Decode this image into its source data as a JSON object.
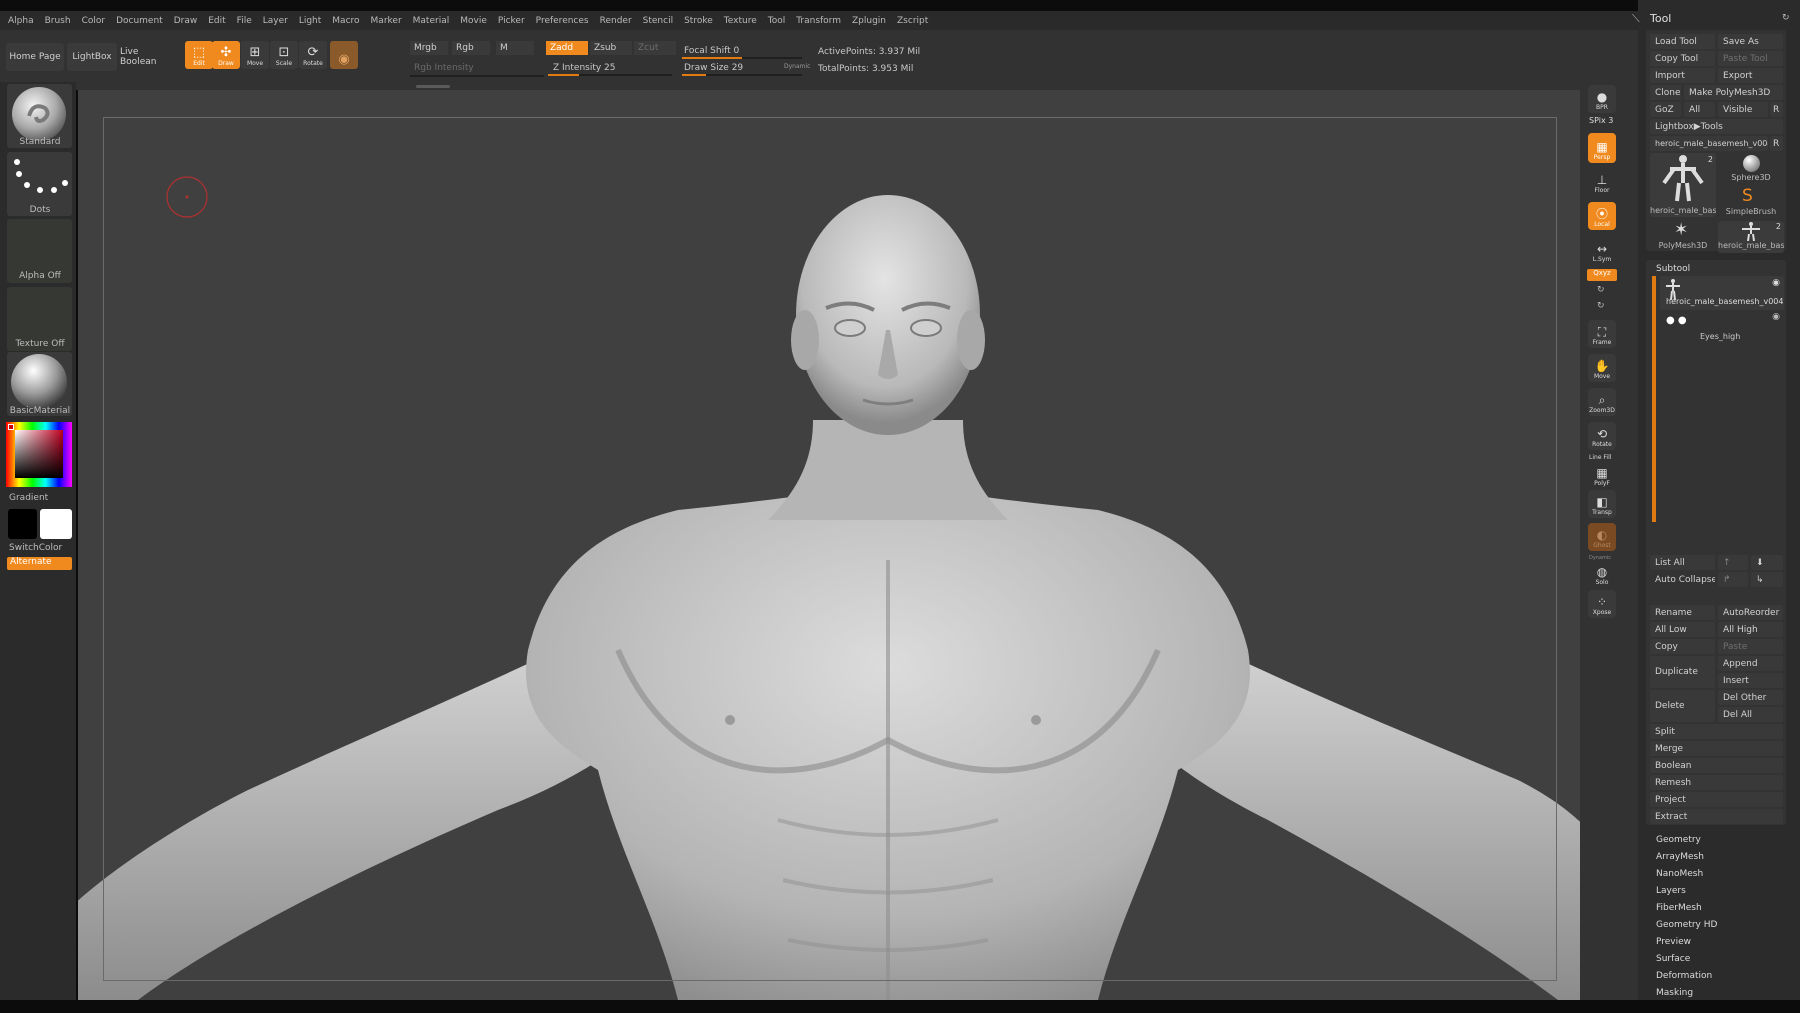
{
  "menu": [
    "Alpha",
    "Brush",
    "Color",
    "Document",
    "Draw",
    "Edit",
    "File",
    "Layer",
    "Light",
    "Macro",
    "Marker",
    "Material",
    "Movie",
    "Picker",
    "Preferences",
    "Render",
    "Stencil",
    "Stroke",
    "Texture",
    "Tool",
    "Transform",
    "Zplugin",
    "Zscript"
  ],
  "shelf": {
    "home_page": "Home Page",
    "lightbox": "LightBox",
    "live_boolean": "Live Boolean",
    "edit": "Edit",
    "draw": "Draw",
    "move": "Move",
    "scale": "Scale",
    "rotate": "Rotate",
    "mrgb": "Mrgb",
    "rgb": "Rgb",
    "m": "M",
    "rgb_intensity": "Rgb Intensity",
    "zadd": "Zadd",
    "zsub": "Zsub",
    "zcut": "Zcut",
    "z_intensity": "Z Intensity 25",
    "z_intensity_value": 0.25,
    "focal_shift": "Focal Shift 0",
    "focal_shift_value": 0.5,
    "draw_size": "Draw Size 29",
    "draw_size_value": 0.2,
    "dynamic": "Dynamic",
    "active_points": "ActivePoints: 3.937 Mil",
    "total_points": "TotalPoints: 3.953 Mil"
  },
  "left": {
    "brush": "Standard",
    "stroke": "Dots",
    "alpha": "Alpha Off",
    "texture": "Texture Off",
    "material": "BasicMaterial",
    "gradient": "Gradient",
    "switch_color": "SwitchColor",
    "alternate": "Alternate"
  },
  "right_shelf": {
    "bpr": "BPR",
    "spix": "SPix 3",
    "persp": "Persp",
    "dynamic": "Dynamic",
    "floor": "Floor",
    "local": "Local",
    "lsym": "L.Sym",
    "xyz": "Qxyz",
    "frame": "Frame",
    "move": "Move",
    "zoom3d": "Zoom3D",
    "rotate": "Rotate",
    "line_fill": "Line Fill",
    "polyf": "PolyF",
    "transp": "Transp",
    "ghost": "Ghost",
    "solo": "Solo",
    "xpose": "Xpose"
  },
  "tool": {
    "title": "Tool",
    "load_tool": "Load Tool",
    "save_as": "Save As",
    "copy_tool": "Copy Tool",
    "paste_tool": "Paste Tool",
    "import": "Import",
    "export": "Export",
    "clone": "Clone",
    "make_polymesh": "Make PolyMesh3D",
    "goz": "GoZ",
    "all": "All",
    "visible": "Visible",
    "r": "R",
    "lightbox_tools": "Lightbox▶Tools",
    "current_tool": "heroic_male_basemesh_v004",
    "thumbs": [
      {
        "label": "heroic_male_bas",
        "count": "2"
      },
      {
        "label": "Sphere3D",
        "count": ""
      },
      {
        "label": "SimpleBrush",
        "count": ""
      },
      {
        "label": "PolyMesh3D",
        "count": ""
      },
      {
        "label": "heroic_male_bas",
        "count": "2"
      }
    ]
  },
  "subtool": {
    "title": "Subtool",
    "items": [
      "heroic_male_basemesh_v004",
      "Eyes_high"
    ],
    "list_all": "List All",
    "auto_collapse": "Auto Collapse",
    "rename": "Rename",
    "auto_reorder": "AutoReorder",
    "all_low": "All Low",
    "all_high": "All High",
    "copy": "Copy",
    "paste": "Paste",
    "duplicate": "Duplicate",
    "append": "Append",
    "insert": "Insert",
    "delete": "Delete",
    "del_other": "Del Other",
    "del_all": "Del All",
    "split": "Split",
    "merge": "Merge",
    "boolean": "Boolean",
    "remesh": "Remesh",
    "project": "Project",
    "extract": "Extract"
  },
  "sections": [
    "Geometry",
    "ArrayMesh",
    "NanoMesh",
    "Layers",
    "FiberMesh",
    "Geometry HD",
    "Preview",
    "Surface",
    "Deformation",
    "Masking"
  ],
  "colors": {
    "accent": "#f08a1e",
    "panel": "#2b2b2b",
    "canvas": "#404040"
  }
}
